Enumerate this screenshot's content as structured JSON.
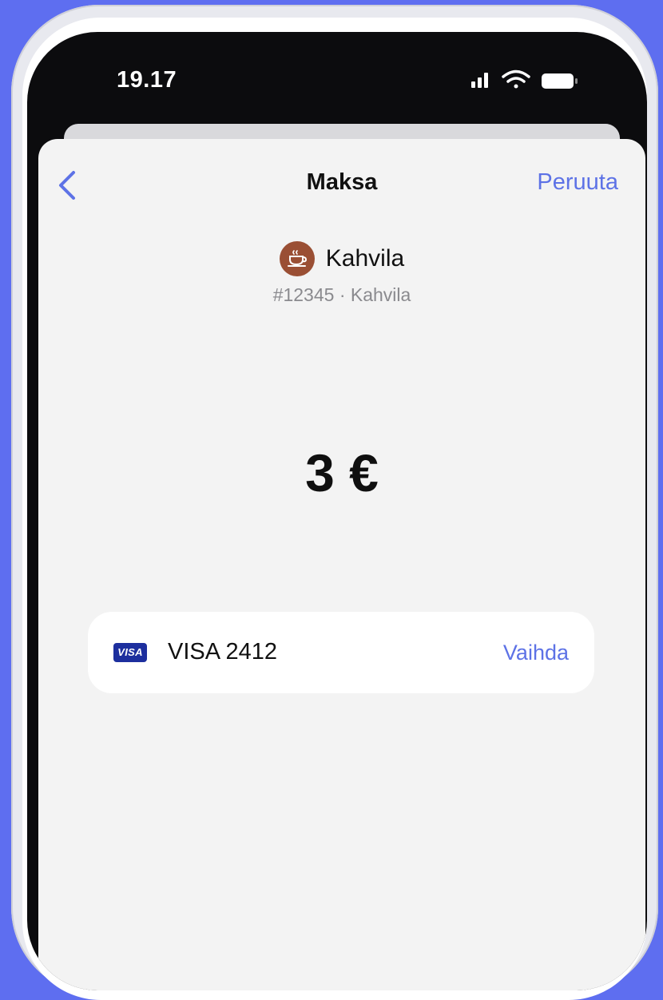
{
  "status_bar": {
    "time": "19.17",
    "icons": [
      "signal-icon",
      "wifi-icon",
      "battery-icon"
    ]
  },
  "nav": {
    "back_icon": "chevron-left-icon",
    "title": "Maksa",
    "cancel_label": "Peruuta"
  },
  "merchant": {
    "icon": "coffee-cup-icon",
    "name": "Kahvila",
    "subtitle": "#12345 · Kahvila"
  },
  "amount": "3 €",
  "payment_method": {
    "brand": "VISA",
    "label": "VISA 2412",
    "change_label": "Vaihda"
  },
  "colors": {
    "background": "#5e6ef0",
    "accent": "#5d72e6",
    "merchant_logo": "#9a4f34",
    "visa": "#1d2f9e"
  }
}
